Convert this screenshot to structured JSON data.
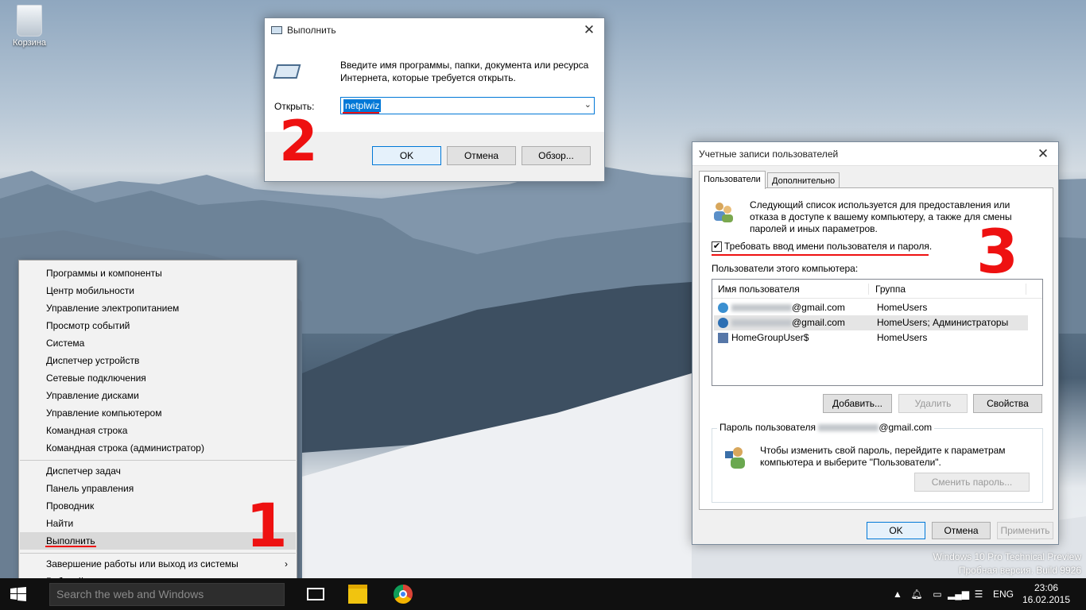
{
  "desktop": {
    "recycle_bin_label": "Корзина",
    "watermark_line1": "Windows 10 Pro Technical Preview",
    "watermark_line2": "Пробная версия. Build 9926"
  },
  "annotations": {
    "step1": "1",
    "step2": "2",
    "step3": "3",
    "accent_color": "#e11111"
  },
  "run_dialog": {
    "title": "Выполнить",
    "description": "Введите имя программы, папки, документа или ресурса Интернета, которые требуется открыть.",
    "open_label": "Открыть:",
    "input_value": "netplwiz",
    "ok": "OK",
    "cancel": "Отмена",
    "browse": "Обзор..."
  },
  "context_menu": {
    "items": [
      "Программы и компоненты",
      "Центр мобильности",
      "Управление электропитанием",
      "Просмотр событий",
      "Система",
      "Диспетчер устройств",
      "Сетевые подключения",
      "Управление дисками",
      "Управление компьютером",
      "Командная строка",
      "Командная строка (администратор)",
      "Диспетчер задач",
      "Панель управления",
      "Проводник",
      "Найти",
      "Выполнить",
      "Завершение работы или выход из системы",
      "Рабочий стол"
    ],
    "highlighted": "Выполнить"
  },
  "user_accounts": {
    "title": "Учетные записи пользователей",
    "tabs": [
      "Пользователи",
      "Дополнительно"
    ],
    "intro": "Следующий список используется для предоставления или отказа в доступе к вашему компьютеру, а также для смены паролей и иных параметров.",
    "require_login_label": "Требовать ввод имени пользователя и пароля.",
    "require_login_checked": true,
    "users_label": "Пользователи этого компьютера:",
    "columns": [
      "Имя пользователя",
      "Группа"
    ],
    "rows": [
      {
        "name_suffix": "@gmail.com",
        "group": "HomeUsers"
      },
      {
        "name_suffix": "@gmail.com",
        "group": "HomeUsers; Администраторы"
      },
      {
        "name_suffix": "HomeGroupUser$",
        "group": "HomeUsers"
      }
    ],
    "add": "Добавить...",
    "remove": "Удалить",
    "properties": "Свойства",
    "password_group_prefix": "Пароль пользователя",
    "password_group_suffix": "@gmail.com",
    "password_text": "Чтобы изменить свой пароль, перейдите к параметрам компьютера и выберите \"Пользователи\".",
    "change_password": "Сменить пароль...",
    "ok": "OK",
    "cancel": "Отмена",
    "apply": "Применить"
  },
  "taskbar": {
    "search_placeholder": "Search the web and Windows",
    "language": "ENG",
    "time": "23:06",
    "date": "16.02.2015"
  }
}
